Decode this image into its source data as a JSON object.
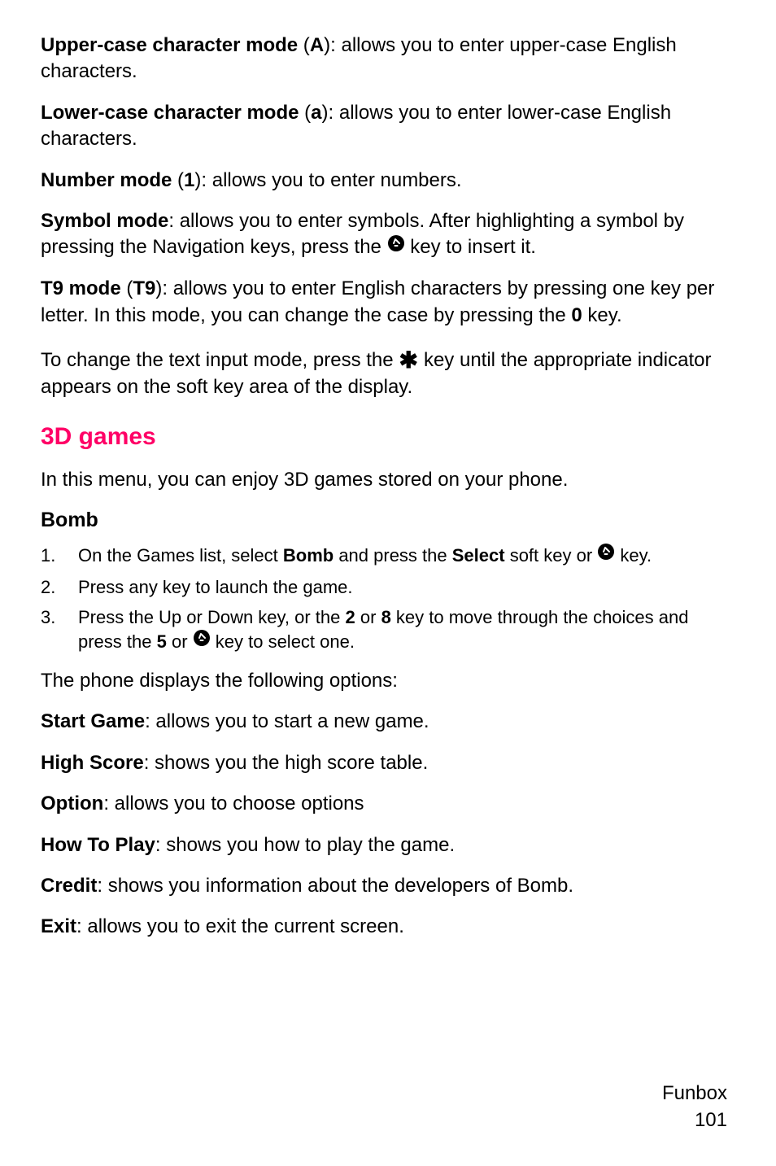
{
  "modes": {
    "upper": {
      "label": "Upper-case character mode",
      "code_open": " (",
      "code": "A",
      "code_close": "): ",
      "desc": "allows you to enter upper-case English characters."
    },
    "lower": {
      "label": "Lower-case character mode",
      "code_open": " (",
      "code": "a",
      "code_close": "): ",
      "desc": "allows you to enter lower-case English characters."
    },
    "number": {
      "label": "Number mode",
      "code_open": " (",
      "code": "1",
      "code_close": "): ",
      "desc": "allows you to enter numbers."
    },
    "symbol": {
      "label": "Symbol mode",
      "colon": ": ",
      "desc_a": "allows you to enter symbols. After highlighting a symbol by pressing the Navigation keys, press the ",
      "desc_b": " key to insert it."
    },
    "t9": {
      "label": "T9 mode",
      "code_open": " (",
      "code": "T9",
      "code_close": "): ",
      "desc_a": "allows you to enter English characters by pressing one key per letter. In this mode, you can change the case by pressing the ",
      "zero": "0",
      "desc_b": " key."
    }
  },
  "change_mode": {
    "a": "To change the text input mode, press the ",
    "star": "✱",
    "b": " key until the appropriate indicator appears on the soft key area of the display."
  },
  "section_3d": {
    "title": "3D games",
    "intro": "In this menu, you can enjoy 3D games stored on your phone."
  },
  "bomb": {
    "title": "Bomb",
    "steps": {
      "s1": {
        "n": "1.",
        "a": "On the Games list, select ",
        "bomb": "Bomb",
        "b": " and press the ",
        "select": "Select",
        "c": " soft key or ",
        "d": " key."
      },
      "s2": {
        "n": "2.",
        "text": "Press any key to launch the game."
      },
      "s3": {
        "n": "3.",
        "a": "Press the Up or Down key, or the ",
        "k2": "2",
        "or1": " or ",
        "k8": "8",
        "b": " key to move through the choices and press the ",
        "k5": "5",
        "or2": " or ",
        "c": " key to select one."
      }
    }
  },
  "options": {
    "intro": "The phone displays the following options:",
    "start": {
      "label": "Start Game",
      "colon": ": ",
      "desc": "allows you to start a new game."
    },
    "high": {
      "label": "High Score",
      "colon": ": ",
      "desc": "shows you the high score table."
    },
    "option": {
      "label": "Option",
      "colon": ": ",
      "desc": "allows you to choose options"
    },
    "how": {
      "label": "How To Play",
      "colon": ": ",
      "desc": "shows you how to play the game."
    },
    "credit": {
      "label": "Credit",
      "colon": ": ",
      "desc": "shows you information about the developers of Bomb."
    },
    "exit": {
      "label": "Exit",
      "colon": ": ",
      "desc": "allows you to exit the current screen."
    }
  },
  "footer": {
    "section": "Funbox",
    "page": "101"
  }
}
